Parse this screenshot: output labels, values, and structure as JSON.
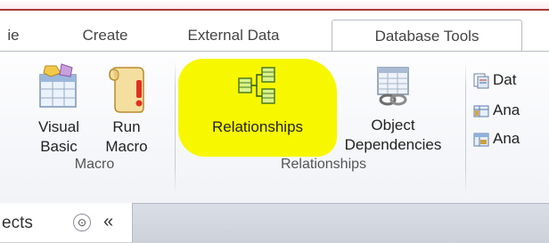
{
  "tabs": [
    {
      "label": "ie",
      "active": false
    },
    {
      "label": "Create",
      "active": false
    },
    {
      "label": "External Data",
      "active": false
    },
    {
      "label": "Database Tools",
      "active": true
    }
  ],
  "ribbon": {
    "macro_group": {
      "label": "Macro",
      "buttons": [
        {
          "line1": "Visual",
          "line2": "Basic"
        },
        {
          "line1": "Run",
          "line2": "Macro"
        }
      ]
    },
    "relationships_group": {
      "label": "Relationships",
      "buttons": [
        {
          "line1": "Relationships",
          "highlighted": true
        },
        {
          "line1": "Object",
          "line2": "Dependencies"
        }
      ]
    },
    "analyze_group": {
      "items": [
        "Dat",
        "Ana",
        "Ana"
      ]
    }
  },
  "nav_pane": {
    "title": "ects",
    "dropdown_glyph": "⊙",
    "collapse_glyph": "«"
  },
  "colors": {
    "highlight": "#f7f700",
    "accent": "#a33a3a"
  }
}
